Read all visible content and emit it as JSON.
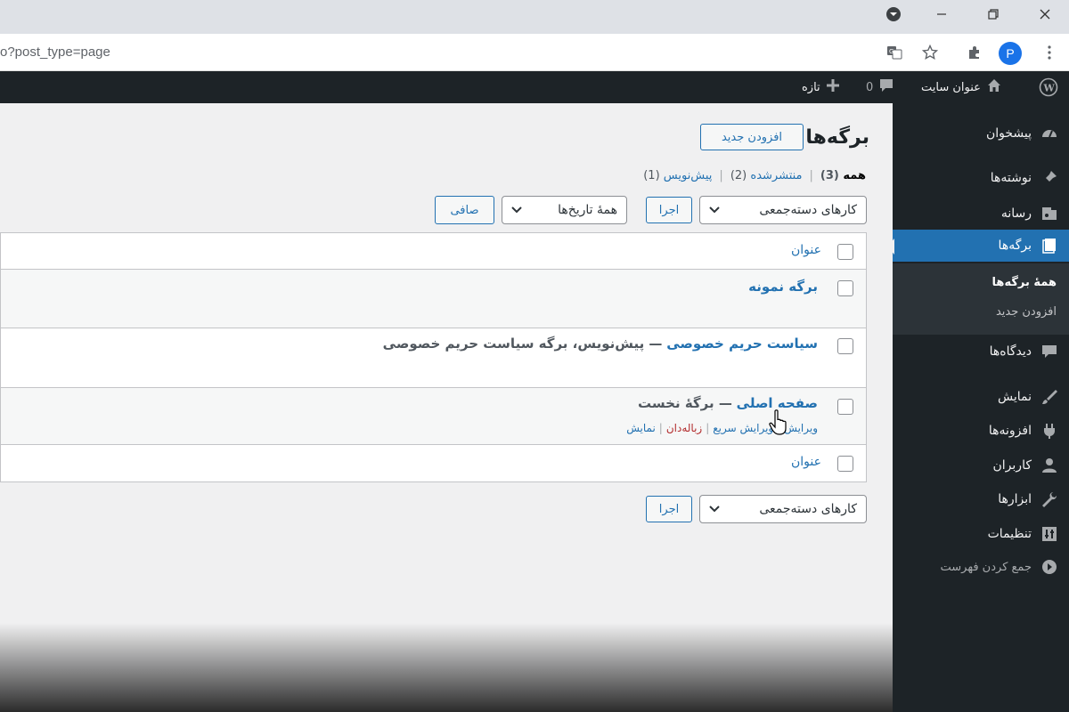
{
  "browser": {
    "url": "o?post_type=page",
    "profile_initial": "P"
  },
  "adminbar": {
    "site_title": "عنوان سایت",
    "comments_count": "0",
    "new_label": "تازه"
  },
  "sidebar": {
    "items": [
      {
        "label": "پیشخوان",
        "icon": "dashboard-icon"
      },
      {
        "label": "نوشته‌ها",
        "icon": "pin-icon"
      },
      {
        "label": "رسانه",
        "icon": "media-icon"
      },
      {
        "label": "برگه‌ها",
        "icon": "pages-icon"
      },
      {
        "label": "دیدگاه‌ها",
        "icon": "comment-icon"
      },
      {
        "label": "نمایش",
        "icon": "brush-icon"
      },
      {
        "label": "افزونه‌ها",
        "icon": "plugin-icon"
      },
      {
        "label": "کاربران",
        "icon": "user-icon"
      },
      {
        "label": "ابزارها",
        "icon": "wrench-icon"
      },
      {
        "label": "تنظیمات",
        "icon": "settings-icon"
      },
      {
        "label": "جمع کردن فهرست",
        "icon": "collapse-icon"
      }
    ],
    "submenu": [
      "همهٔ برگه‌ها",
      "افزودن جدید"
    ]
  },
  "page": {
    "title": "برگه‌ها",
    "add_new": "افزودن جدید",
    "filters": {
      "all_label": "همه",
      "all_count": "(3)",
      "published_label": "منتشرشده",
      "published_count": "(2)",
      "draft_label": "پیش‌نویس",
      "draft_count": "(1)"
    },
    "bulk_actions": "کارهای دسته‌جمعی",
    "apply": "اجرا",
    "all_dates": "همهٔ تاریخ‌ها",
    "filter_button": "صافی",
    "column_title": "عنوان",
    "rows": [
      {
        "title": "برگه نمونه",
        "state": ""
      },
      {
        "title": "سیاست حریم خصوصی",
        "state": "— پیش‌نویس، برگه سیاست حریم خصوصی"
      },
      {
        "title": "صفحه اصلی",
        "state": "— برگهٔ نخست"
      }
    ],
    "row_actions": {
      "edit": "ویرایش",
      "quick_edit": "ویرایش سریع",
      "trash": "زباله‌دان",
      "view": "نمایش"
    }
  }
}
